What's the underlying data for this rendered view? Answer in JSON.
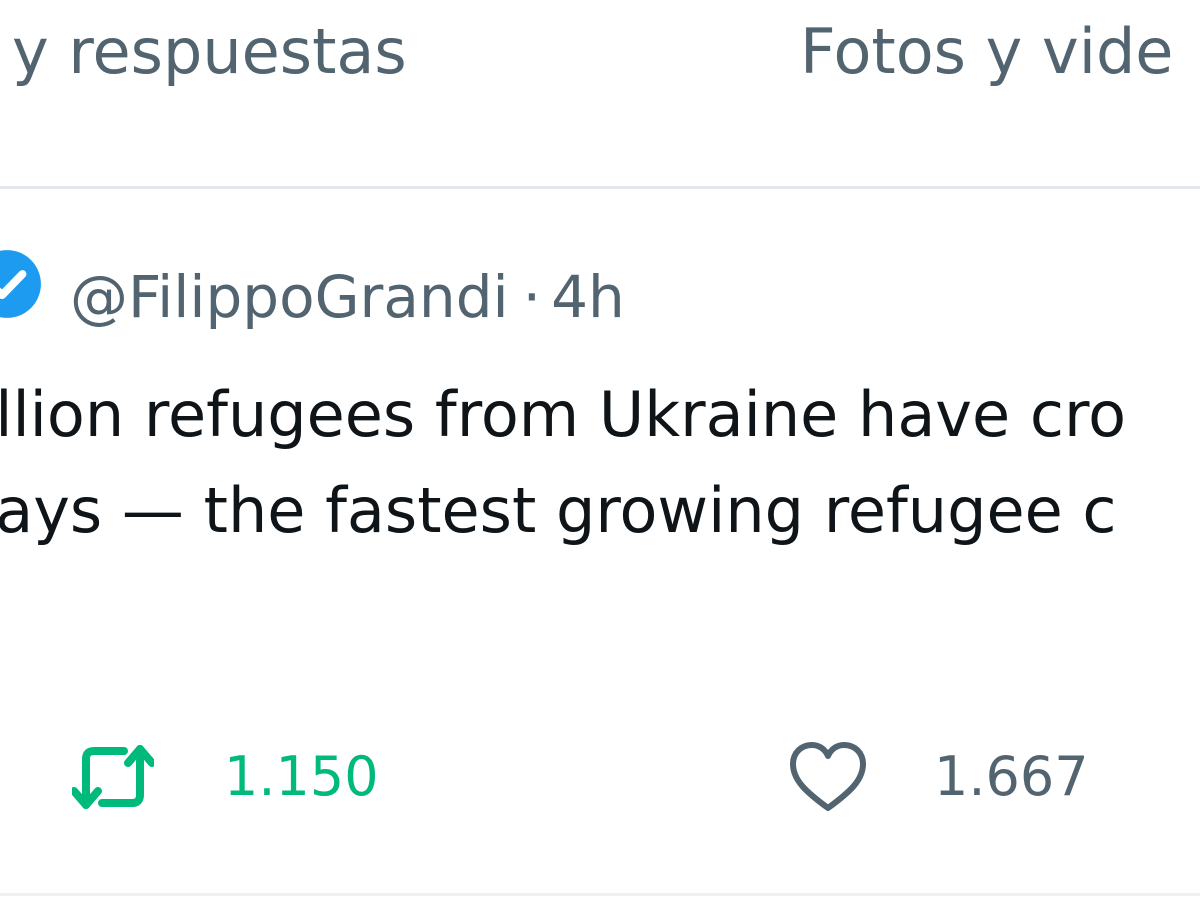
{
  "tabs": {
    "replies_label": "s y respuestas",
    "media_label": "Fotos y vide"
  },
  "tweet": {
    "handle": "@FilippoGrandi",
    "separator": "·",
    "time": "4h",
    "text_line_1": "illion refugees from Ukraine have cro",
    "text_line_2": "lays — the fastest growing refugee c",
    "retweet_count": "1.150",
    "like_count": "1.667"
  },
  "colors": {
    "verified": "#1d9bf0",
    "retweet": "#00ba7c",
    "secondary_text": "#536471"
  },
  "icons": {
    "verified": "verified-badge-icon",
    "retweet": "retweet-icon",
    "like": "heart-icon"
  }
}
